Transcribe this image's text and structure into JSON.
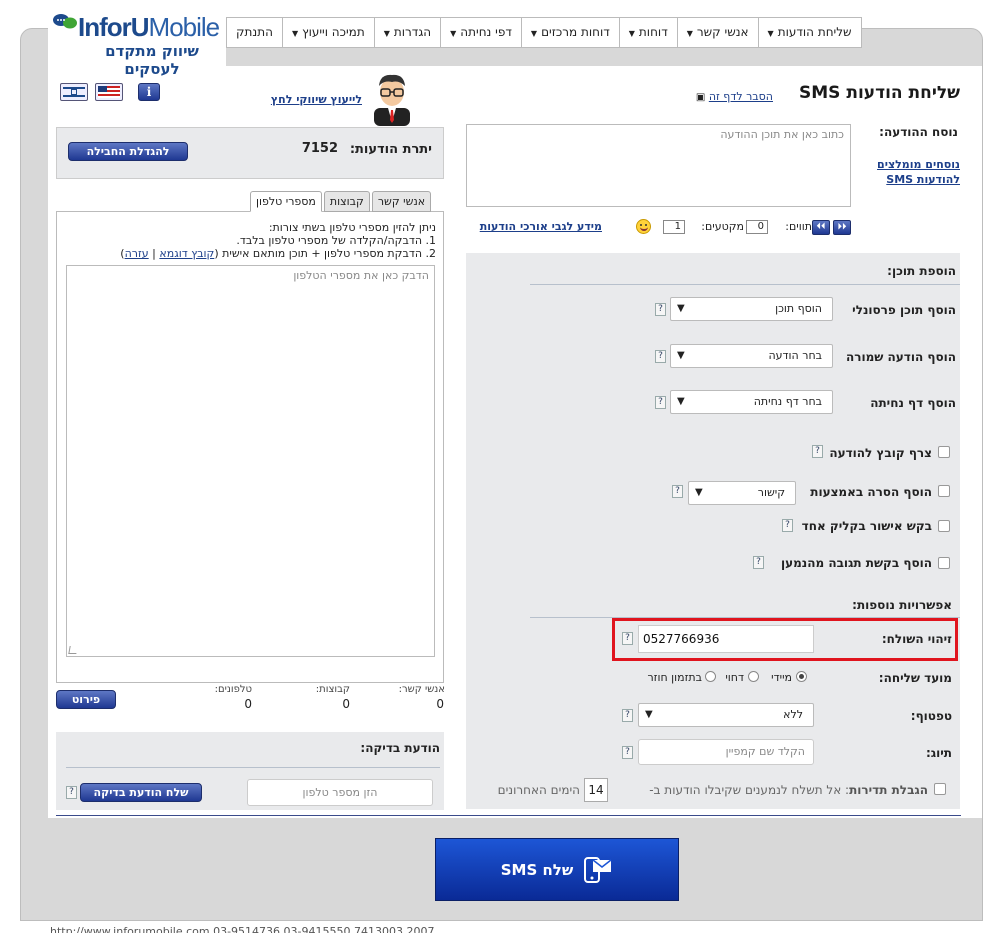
{
  "nav": {
    "items": [
      "שליחת הודעות",
      "אנשי קשר",
      "דוחות",
      "דוחות מרכזים",
      "דפי נחיתה",
      "הגדרות",
      "תמיכה וייעוץ",
      "התנתק"
    ],
    "has_caret": [
      true,
      true,
      true,
      true,
      true,
      true,
      true,
      false
    ]
  },
  "logo": {
    "brand_main": "InforU",
    "brand_sub": "Mobile",
    "tagline": "שיווק מתקדם לעסקים"
  },
  "page": {
    "title": "שליחת הודעות SMS",
    "help_link": "הסבר לדף זה"
  },
  "advisor": {
    "link": "לייעוץ שיווקי לחץ"
  },
  "message": {
    "label": "נוסח ההודעה:",
    "placeholder": "כתוב כאן את תוכן ההודעה",
    "recommended_link": "נוסחים מומלצים להודעות SMS",
    "long_link": "מידע לגבי אורכי הודעות",
    "segments_label": "מקטעים:",
    "segments_value": "1",
    "chars_label": "תווים:",
    "chars_value": "0"
  },
  "content": {
    "header": "הוספת תוכן:",
    "personal_label": "הוסף תוכן פרסונלי",
    "personal_value": "הוסף תוכן",
    "saved_label": "הוסף הודעה שמורה",
    "saved_value": "בחר הודעה",
    "landing_label": "הוסף דף נחיתה",
    "landing_value": "בחר דף נחיתה",
    "attach_label": "צרף קובץ להודעה",
    "image_label": "הוסף הסרה באמצעות",
    "image_value": "קישור",
    "confirm_label": "בקש אישור בקליק אחד",
    "reply_label": "הוסף בקשת תגובה מהנמען"
  },
  "options": {
    "header": "אפשרויות נוספות:",
    "sender_label": "זיהוי השולח:",
    "sender_value": "0527766936",
    "timing_label": "מועד שליחה:",
    "timing_now": "מיידי",
    "timing_delay": "דחוי",
    "timing_recurring": "בתזמון חוזר",
    "filter_label": "טפטוף:",
    "filter_value": "ללא",
    "tag_label": "תיוג:",
    "tag_placeholder": "הקלד שם קמפיין",
    "limit_bold": "הגבלת תדירות",
    "limit_text": ": אל תשלח לנמענים שקיבלו הודעות ב-",
    "limit_days": "14",
    "limit_suffix": "הימים האחרונים"
  },
  "balance": {
    "label": "יתרת הודעות:",
    "value": "7152",
    "button": "להגדלת החבילה"
  },
  "tabs": [
    "אנשי קשר",
    "קבוצות",
    "מספרי טלפון"
  ],
  "phones": {
    "intro": "ניתן להזין מספרי טלפון בשתי צורות:",
    "line1": "1. הדבקה/הקלדה של מספרי טלפון בלבד.",
    "line2": "2. הדבקת מספרי טלפון + תוכן מותאם אישית",
    "sample_link": "קובץ דוגמא",
    "help_link": "עזרה",
    "placeholder": "הדבק כאן את מספרי הטלפון"
  },
  "counts": {
    "contacts_label": "אנשי קשר:",
    "contacts_value": "0",
    "groups_label": "קבוצות:",
    "groups_value": "0",
    "phones_label": "טלפונים:",
    "phones_value": "0",
    "detail_button": "פירוט"
  },
  "test": {
    "header": "הודעת בדיקה:",
    "placeholder": "הזן מספר טלפון",
    "button": "שלח הודעת בדיקה"
  },
  "send": {
    "label": "שלח SMS"
  },
  "footer": {
    "text": "http://www.inforumobile.com   03-9514736   03-9415550   7413003   2007"
  },
  "colors": {
    "highlight": "#e0141e",
    "button_blue": "#1f3892"
  }
}
